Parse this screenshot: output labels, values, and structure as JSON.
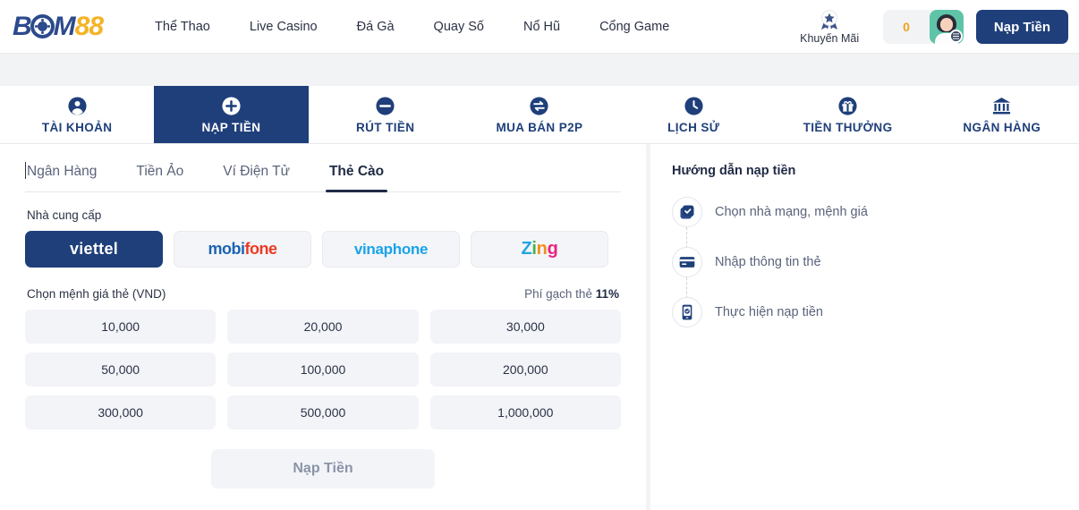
{
  "header": {
    "logo": {
      "part1": "B",
      "ball": "O",
      "part2": "M",
      "part3": "88",
      "alt": "BOM88"
    },
    "nav": [
      {
        "label": "Thể Thao"
      },
      {
        "label": "Live Casino"
      },
      {
        "label": "Đá Gà"
      },
      {
        "label": "Quay Số"
      },
      {
        "label": "Nổ Hũ"
      },
      {
        "label": "Cổng Game"
      }
    ],
    "promo": {
      "label": "Khuyến Mãi",
      "icon": "award-badge-icon"
    },
    "balance": "0",
    "avatar_icon": "user-avatar",
    "deposit_button": "Nạp Tiền"
  },
  "account_tabs": [
    {
      "label": "TÀI KHOẢN",
      "icon": "user-circle-icon",
      "active": false
    },
    {
      "label": "NẠP TIỀN",
      "icon": "plus-circle-icon",
      "active": true
    },
    {
      "label": "RÚT TIỀN",
      "icon": "minus-circle-icon",
      "active": false
    },
    {
      "label": "MUA BÁN P2P",
      "icon": "exchange-circle-icon",
      "active": false
    },
    {
      "label": "LỊCH SỬ",
      "icon": "clock-icon",
      "active": false
    },
    {
      "label": "TIỀN THƯỞNG",
      "icon": "gift-icon",
      "active": false
    },
    {
      "label": "NGÂN HÀNG",
      "icon": "bank-icon",
      "active": false
    }
  ],
  "deposit": {
    "method_tabs": [
      {
        "label": "Ngân Hàng",
        "active": false
      },
      {
        "label": "Tiền Ảo",
        "active": false
      },
      {
        "label": "Ví Điện Tử",
        "active": false
      },
      {
        "label": "Thẻ Cào",
        "active": true
      }
    ],
    "provider_label": "Nhà cung cấp",
    "providers": [
      {
        "name": "viettel",
        "active": true
      },
      {
        "name": "mobifone",
        "part1": "mobi",
        "part2": "fone",
        "active": false
      },
      {
        "name": "vinaphone",
        "active": false
      },
      {
        "name": "Zing",
        "z1": "Z",
        "z2": "i",
        "z3": "n",
        "z4": "g",
        "active": false
      }
    ],
    "denom_label": "Chọn mệnh giá thẻ (VND)",
    "fee_label": "Phí gạch thẻ",
    "fee_value": "11%",
    "denominations": [
      "10,000",
      "20,000",
      "30,000",
      "50,000",
      "100,000",
      "200,000",
      "300,000",
      "500,000",
      "1,000,000"
    ],
    "submit_label": "Nạp Tiền"
  },
  "guide": {
    "title": "Hướng dẫn nạp tiền",
    "steps": [
      {
        "label": "Chọn nhà mạng, mệnh giá",
        "icon": "check-circle-icon"
      },
      {
        "label": "Nhập thông tin thẻ",
        "icon": "credit-card-icon"
      },
      {
        "label": "Thực hiện nạp tiền",
        "icon": "mobile-check-icon"
      }
    ]
  },
  "colors": {
    "brand_navy": "#1f3f7a",
    "brand_yellow": "#f5b324",
    "balance_amber": "#f0a11e",
    "panel_gray": "#f2f3f5",
    "tile_gray": "#f2f4f8"
  }
}
